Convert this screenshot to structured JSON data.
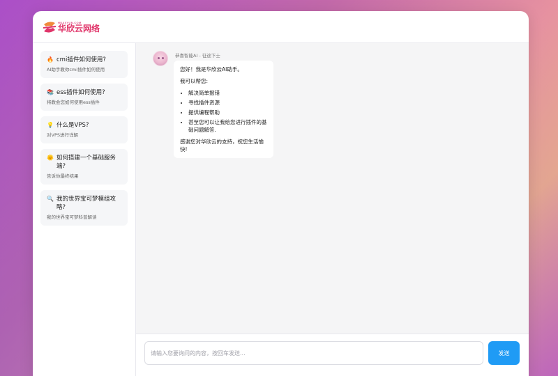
{
  "brand": {
    "logo_small": "HUAXYUN.COM",
    "logo_text": "华欣云网络",
    "colors": {
      "accent": "#e0356a",
      "send": "#1f9bf5"
    }
  },
  "sidebar": {
    "items": [
      {
        "icon": "fire-icon",
        "glyph": "🔥",
        "title": "cmi插件如何使用?",
        "subtitle": "AI助手教你cmi插件如何使用"
      },
      {
        "icon": "books-icon",
        "glyph": "📚",
        "title": "ess插件如何使用?",
        "subtitle": "将教会您如何使用ess插件"
      },
      {
        "icon": "lightbulb-icon",
        "glyph": "💡",
        "title": "什么是VPS?",
        "subtitle": "对VPS进行详解"
      },
      {
        "icon": "sun-icon",
        "glyph": "🌞",
        "title": "如何搭建一个基础服务端?",
        "subtitle": "告诉你最终结果"
      },
      {
        "icon": "magnifier-icon",
        "glyph": "🔍",
        "title": "我的世界宝可梦模组攻略?",
        "subtitle": "我的世界宝可梦科普解读"
      }
    ]
  },
  "chat": {
    "sender": "恭喜智能AI - 征途下士",
    "greeting": "您好！我是华欣云AI助手。",
    "intro": "我可以帮您:",
    "bullets": [
      "解决简单报错",
      "寻找插件资源",
      "提供编程帮助",
      "甚至您可以让我给您进行插件的基础问题解答."
    ],
    "closing": "感谢您对华欣云的支持，祝您生活愉快!"
  },
  "composer": {
    "placeholder": "请输入您要询问的内容，按回车发送...",
    "value": "",
    "send_label": "发送"
  }
}
